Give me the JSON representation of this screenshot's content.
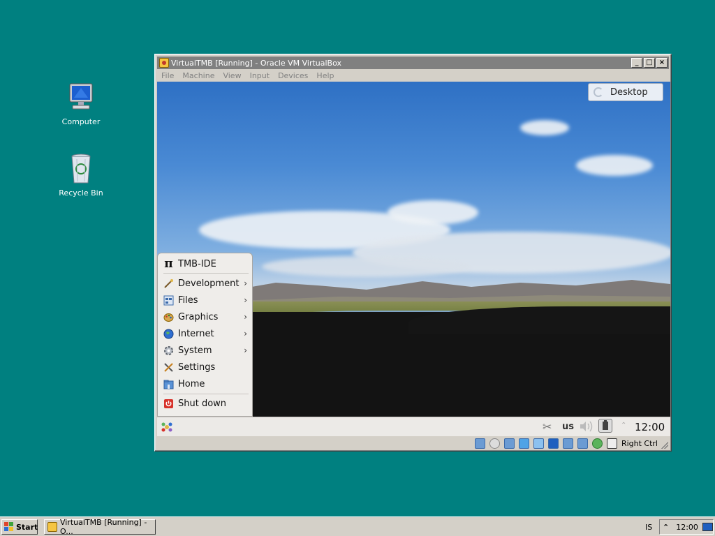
{
  "desktop": {
    "icons": [
      {
        "label": "Computer"
      },
      {
        "label": "Recycle Bin"
      }
    ],
    "background_color": "#008080"
  },
  "vbox_window": {
    "title": "VirtualTMB [Running] - Oracle VM VirtualBox",
    "title_buttons": [
      "_",
      "□",
      "×"
    ],
    "menu": [
      "File",
      "Machine",
      "View",
      "Input",
      "Devices",
      "Help"
    ],
    "status_host_key": "Right Ctrl"
  },
  "guest": {
    "desktop_pill": "Desktop",
    "start_menu": {
      "items": [
        {
          "label": "TMB-IDE",
          "icon": "pi-icon",
          "submenu": false
        },
        {
          "label": "Development",
          "icon": "development-icon",
          "submenu": true
        },
        {
          "label": "Files",
          "icon": "files-icon",
          "submenu": true
        },
        {
          "label": "Graphics",
          "icon": "graphics-icon",
          "submenu": true
        },
        {
          "label": "Internet",
          "icon": "internet-icon",
          "submenu": true
        },
        {
          "label": "System",
          "icon": "system-icon",
          "submenu": true
        },
        {
          "label": "Settings",
          "icon": "settings-icon",
          "submenu": false
        },
        {
          "label": "Home",
          "icon": "home-icon",
          "submenu": false
        },
        {
          "label": "Shut down",
          "icon": "shutdown-icon",
          "submenu": false
        }
      ]
    },
    "panel": {
      "keyboard_layout": "us",
      "clock": "12:00"
    }
  },
  "taskbar": {
    "start_label": "Start",
    "task_label": "VirtualTMB [Running] - O...",
    "language": "IS",
    "clock": "12:00"
  }
}
